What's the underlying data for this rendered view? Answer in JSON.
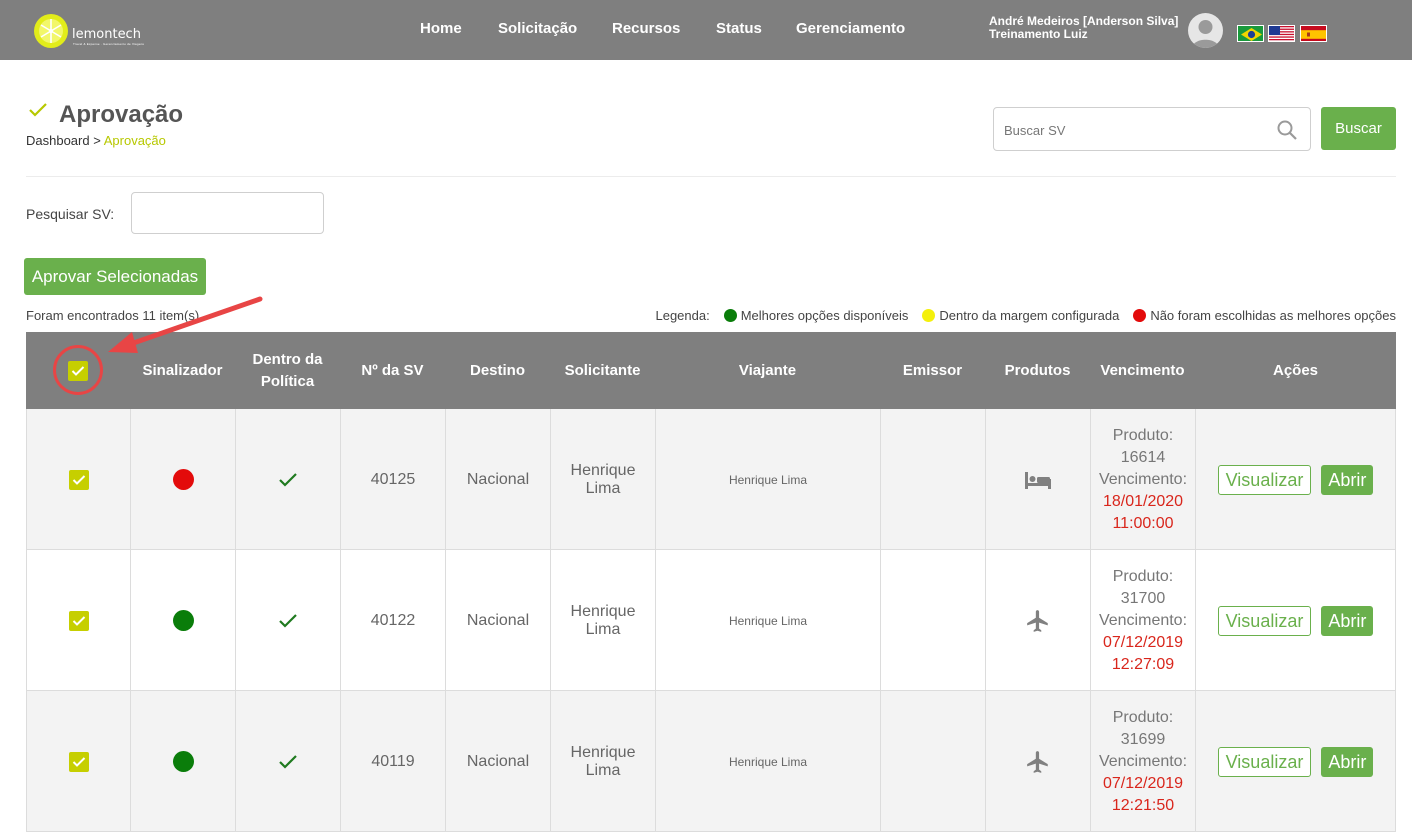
{
  "brand": {
    "name": "lemontech",
    "tagline": "Travel & Expense · Gerenciamento de Viagens"
  },
  "nav": {
    "home": "Home",
    "solicitacao": "Solicitação",
    "recursos": "Recursos",
    "status": "Status",
    "gerenciamento": "Gerenciamento"
  },
  "user": {
    "name": "André Medeiros [Anderson Silva]",
    "context": "Treinamento Luiz"
  },
  "flags": [
    "flag-brazil",
    "flag-usa",
    "flag-spain"
  ],
  "page": {
    "title": "Aprovação",
    "breadcrumb_root": "Dashboard",
    "breadcrumb_sep": ">",
    "breadcrumb_active": "Aprovação"
  },
  "search": {
    "placeholder": "Buscar SV",
    "button": "Buscar"
  },
  "filter": {
    "label": "Pesquisar SV:",
    "value": ""
  },
  "actions": {
    "approve_selected": "Aprovar Selecionadas"
  },
  "results": {
    "found_text": "Foram encontrados 11 item(s)"
  },
  "legend": {
    "label": "Legenda:",
    "items": [
      {
        "color": "#0a7d0a",
        "text": "Melhores opções disponíveis"
      },
      {
        "color": "#f4f00c",
        "text": "Dentro da margem configurada"
      },
      {
        "color": "#e30b0b",
        "text": "Não foram escolhidas as melhores opções"
      }
    ]
  },
  "table": {
    "headers": {
      "sinalizador": "Sinalizador",
      "politica_1": "Dentro da",
      "politica_2": "Política",
      "sv": "Nº da SV",
      "destino": "Destino",
      "solicitante": "Solicitante",
      "viajante": "Viajante",
      "emissor": "Emissor",
      "produtos": "Produtos",
      "vencimento": "Vencimento",
      "acoes": "Ações"
    },
    "rows": [
      {
        "checked": true,
        "signal": "#e30b0b",
        "policy_ok": true,
        "sv": "40125",
        "destino": "Nacional",
        "solicitante": "Henrique Lima",
        "viajante": "Henrique Lima",
        "emissor": "",
        "product_icon": "hotel-bed-icon",
        "produto_label": "Produto:",
        "produto_id": "16614",
        "venc_label": "Vencimento:",
        "venc_date": "18/01/2020",
        "venc_time": "11:00:00",
        "btn_view": "Visualizar",
        "btn_open": "Abrir"
      },
      {
        "checked": true,
        "signal": "#0a7d0a",
        "policy_ok": true,
        "sv": "40122",
        "destino": "Nacional",
        "solicitante": "Henrique Lima",
        "viajante": "Henrique Lima",
        "emissor": "",
        "product_icon": "airplane-icon",
        "produto_label": "Produto:",
        "produto_id": "31700",
        "venc_label": "Vencimento:",
        "venc_date": "07/12/2019",
        "venc_time": "12:27:09",
        "btn_view": "Visualizar",
        "btn_open": "Abrir"
      },
      {
        "checked": true,
        "signal": "#0a7d0a",
        "policy_ok": true,
        "sv": "40119",
        "destino": "Nacional",
        "solicitante": "Henrique Lima",
        "viajante": "Henrique Lima",
        "emissor": "",
        "product_icon": "airplane-icon",
        "produto_label": "Produto:",
        "produto_id": "31699",
        "venc_label": "Vencimento:",
        "venc_date": "07/12/2019",
        "venc_time": "12:21:50",
        "btn_view": "Visualizar",
        "btn_open": "Abrir"
      }
    ]
  },
  "colors": {
    "topbar": "#7f7f7f",
    "accent_green": "#6ab04c",
    "lime": "#c6cf00",
    "annotation_red": "#e84545"
  }
}
